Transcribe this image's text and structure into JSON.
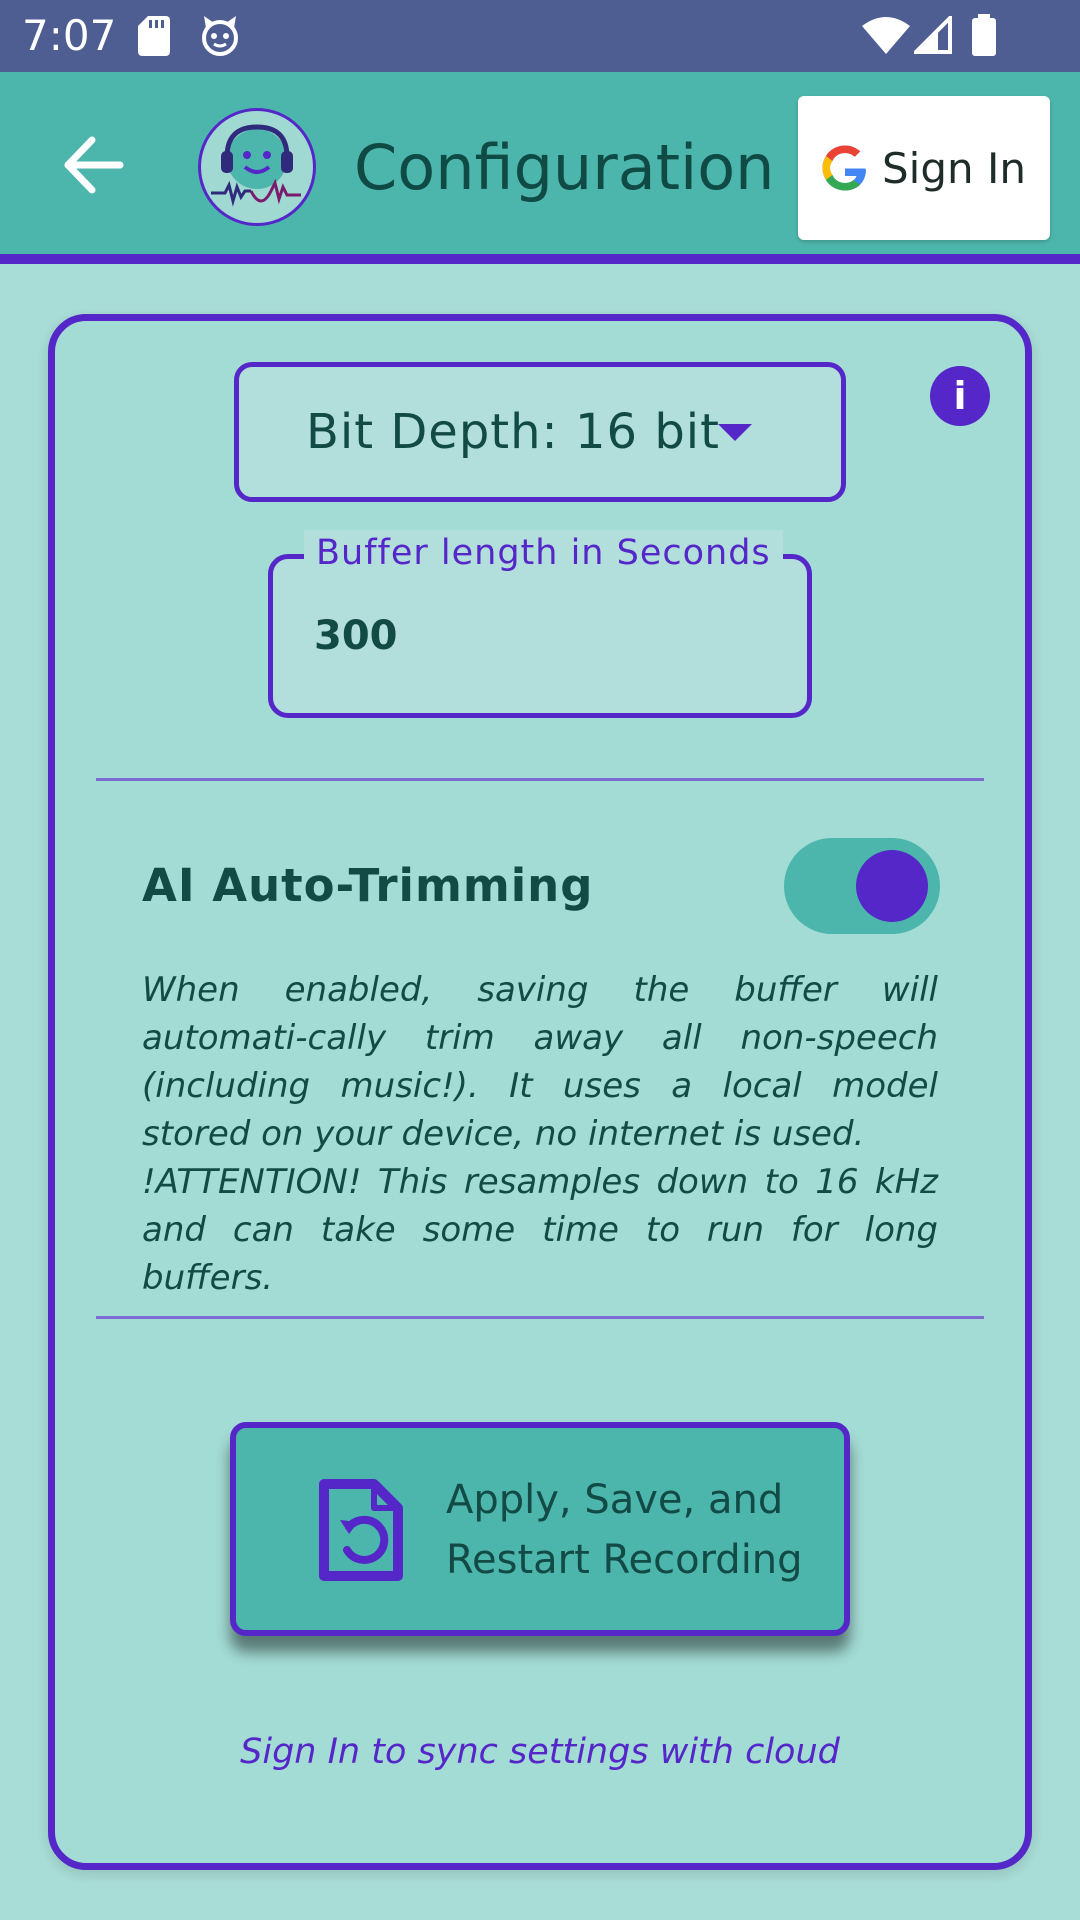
{
  "status_bar": {
    "time": "7:07",
    "icons": [
      "sd-card-icon",
      "cat-face-icon",
      "wifi-icon",
      "signal-icon",
      "battery-icon"
    ],
    "background": "#4e5e92"
  },
  "app_bar": {
    "title": "Configuration",
    "back_icon": "arrow-left-icon",
    "logo_icon": "smiling-headphones-logo",
    "sign_in_label": "Sign In",
    "sign_in_icon": "google-g-icon",
    "background": "#4db6ac",
    "accent": "#5527c9"
  },
  "settings": {
    "bit_depth_label": "Bit Depth: 16 bit",
    "bit_depth_icon": "caret-down-icon",
    "info_icon": "info-icon",
    "buffer_legend": "Buffer length in Seconds",
    "buffer_value": "300",
    "ai_trim_label": "AI Auto-Trimming",
    "ai_trim_enabled": true,
    "description_line1": "When enabled, saving the buffer will automati-cally trim away all non-speech (including music!). It uses a local model stored on your device, no internet is used.",
    "description_line2": "!ATTENTION! This resamples down to 16 kHz and can take some time to run for long buffers.",
    "apply_label": "Apply, Save, and Restart Recording",
    "apply_icon": "file-restore-icon",
    "cloud_note": "Sign In to sync settings with cloud"
  },
  "colors": {
    "background": "#a8dcd6",
    "card": "#a3dcd5",
    "field": "#b2dfdb",
    "text": "#124a45",
    "primary": "#5527c9",
    "teal": "#4db6ac"
  }
}
